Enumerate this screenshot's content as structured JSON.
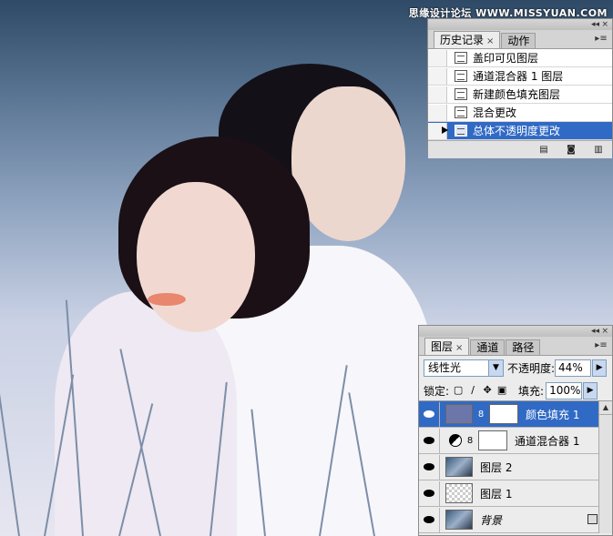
{
  "watermark": "思缘设计论坛 WWW.MISSYUAN.COM",
  "history_panel": {
    "tabs": [
      {
        "label": "历史记录",
        "close": "×",
        "active": true
      },
      {
        "label": "动作",
        "active": false
      }
    ],
    "items": [
      {
        "label": "盖印可见图层",
        "active": false
      },
      {
        "label": "通道混合器 1 图层",
        "active": false
      },
      {
        "label": "新建颜色填充图层",
        "active": false
      },
      {
        "label": "混合更改",
        "active": false
      },
      {
        "label": "总体不透明度更改",
        "active": true
      }
    ]
  },
  "layers_panel": {
    "tabs": [
      {
        "label": "图层",
        "close": "×",
        "active": true
      },
      {
        "label": "通道",
        "active": false
      },
      {
        "label": "路径",
        "active": false
      }
    ],
    "blend_mode": "线性光",
    "opacity_label": "不透明度:",
    "opacity_value": "44%",
    "lock_label": "锁定:",
    "fill_label": "填充:",
    "fill_value": "100%",
    "layers": [
      {
        "name": "颜色填充 1",
        "type": "fill",
        "active": true
      },
      {
        "name": "通道混合器 1",
        "type": "adjustment",
        "active": false
      },
      {
        "name": "图层 2",
        "type": "photo",
        "active": false
      },
      {
        "name": "图层 1",
        "type": "transparent",
        "active": false
      },
      {
        "name": "背景",
        "type": "background",
        "active": false,
        "locked": true
      }
    ]
  }
}
